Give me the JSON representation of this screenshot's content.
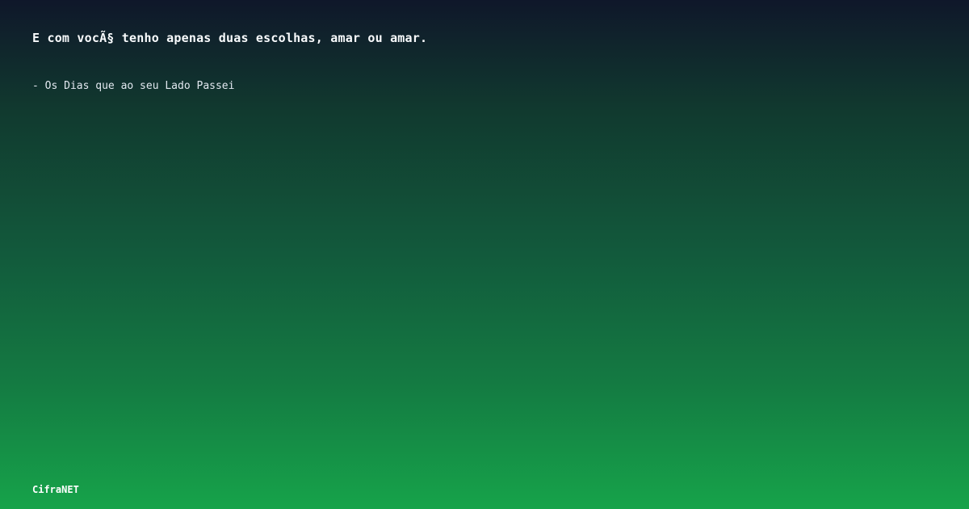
{
  "quote": {
    "text": "E com vocÃ§ tenho apenas duas escolhas, amar ou amar."
  },
  "attribution": {
    "text": "- Os Dias que ao seu Lado Passei"
  },
  "brand": {
    "name": "CifraNET"
  },
  "colors": {
    "gradient_top": "#0f172a",
    "gradient_bottom": "#16a34a",
    "text": "#ffffff"
  }
}
